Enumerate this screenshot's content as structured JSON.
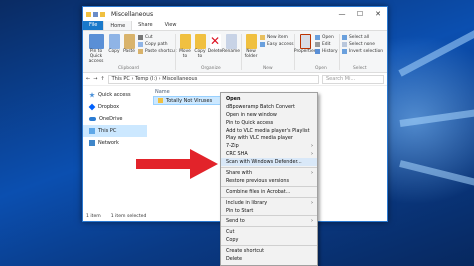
{
  "window": {
    "title": "Miscellaneous",
    "controls": [
      "—",
      "☐",
      "✕"
    ]
  },
  "tabs": [
    "File",
    "Home",
    "Share",
    "View"
  ],
  "ribbon": {
    "pin_label": "Pin to Quick access",
    "copy_label": "Copy",
    "paste_label": "Paste",
    "cut_label": "Cut",
    "copy_path_label": "Copy path",
    "paste_shortcut_label": "Paste shortcut",
    "clipboard_group": "Clipboard",
    "move_label": "Move to",
    "copy_to_label": "Copy to",
    "delete_label": "Delete",
    "rename_label": "Rename",
    "organize_group": "Organize",
    "new_item_label": "New item",
    "easy_access_label": "Easy access",
    "new_folder_label": "New folder",
    "new_group": "New",
    "properties_label": "Properties",
    "open_label": "Open",
    "edit_label": "Edit",
    "history_label": "History",
    "open_group": "Open",
    "select_all_label": "Select all",
    "select_none_label": "Select none",
    "invert_selection_label": "Invert selection",
    "select_group": "Select"
  },
  "address": {
    "path": "This PC  ›  Temp (I:)  ›  Miscellaneous",
    "search_placeholder": "Search Mi..."
  },
  "nav": [
    {
      "label": "Quick access",
      "icon": "star-icon"
    },
    {
      "label": "Dropbox",
      "icon": "dropbox-icon"
    },
    {
      "label": "OneDrive",
      "icon": "cloud-icon"
    },
    {
      "label": "This PC",
      "icon": "computer-icon"
    },
    {
      "label": "Network",
      "icon": "network-icon"
    }
  ],
  "filepane": {
    "column": "Name",
    "file": "Totally Not Viruses"
  },
  "status": {
    "items": "1 item",
    "selected": "1 item selected"
  },
  "context_menu": [
    {
      "label": "Open",
      "bold": true
    },
    {
      "label": "dBpoweramp Batch Convert"
    },
    {
      "label": "Open in new window"
    },
    {
      "label": "Pin to Quick access"
    },
    {
      "label": "Add to VLC media player's Playlist"
    },
    {
      "label": "Play with VLC media player"
    },
    {
      "label": "7-Zip",
      "submenu": true
    },
    {
      "label": "CRC SHA",
      "submenu": true
    },
    {
      "label": "Scan with Windows Defender...",
      "highlighted": true
    },
    {
      "sep": true
    },
    {
      "label": "Share with",
      "submenu": true
    },
    {
      "label": "Restore previous versions"
    },
    {
      "sep": true
    },
    {
      "label": "Combine files in Acrobat..."
    },
    {
      "sep": true
    },
    {
      "label": "Include in library",
      "submenu": true
    },
    {
      "label": "Pin to Start"
    },
    {
      "sep": true
    },
    {
      "label": "Send to",
      "submenu": true
    },
    {
      "sep": true
    },
    {
      "label": "Cut"
    },
    {
      "label": "Copy"
    },
    {
      "sep": true
    },
    {
      "label": "Create shortcut"
    },
    {
      "label": "Delete"
    }
  ],
  "colors": {
    "accent": "#1979ca",
    "arrow": "#e2232a",
    "selection": "#cce8ff"
  }
}
